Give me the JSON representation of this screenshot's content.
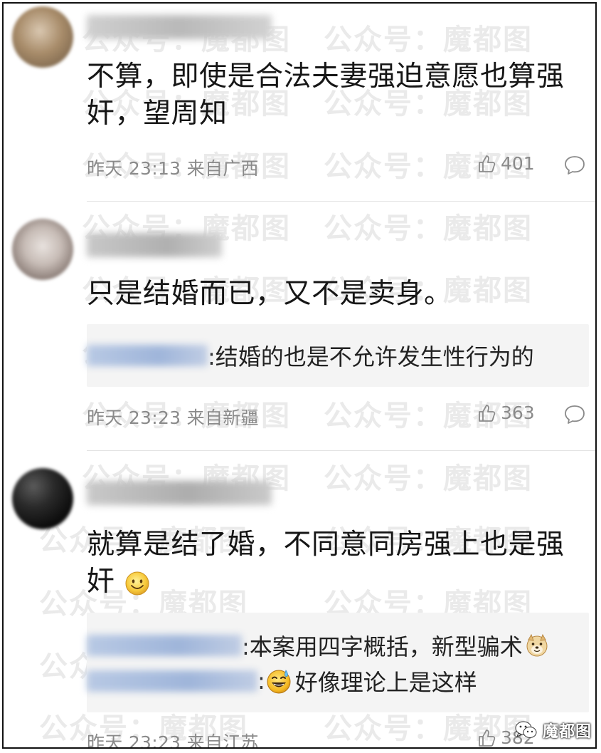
{
  "watermark": "公众号：魔都图",
  "brand_logo": "魔都图",
  "comments": [
    {
      "text": "不算，即使是合法夫妻强迫意愿也算强奸，望周知",
      "time": "昨天 23:13 来自广西",
      "likes": "401",
      "replies": []
    },
    {
      "text": "只是结婚而已，又不是卖身。",
      "time": "昨天 23:23 来自新疆",
      "likes": "363",
      "replies": [
        {
          "text": ":结婚的也是不允许发生性行为的"
        }
      ]
    },
    {
      "text": "就算是结了婚，不同意同房强上也是强奸",
      "time": "昨天 23:23 来自江苏",
      "likes": "382",
      "replies": [
        {
          "text": ":本案用四字概括，新型骗术"
        },
        {
          "text": "好像理论上是这样"
        }
      ]
    }
  ],
  "icons": {
    "like": "thumbs-up-icon",
    "reply": "speech-bubble-icon",
    "smile": "smile-emoji-icon",
    "doge": "doge-emoji-icon",
    "sweat": "sweat-smile-emoji-icon",
    "logo": "wechat-logo-icon"
  },
  "colors": {
    "text": "#161616",
    "meta": "#8a8a8a",
    "reply_bg": "#f4f4f4",
    "reply_user_blur": "#a8bcdc"
  }
}
